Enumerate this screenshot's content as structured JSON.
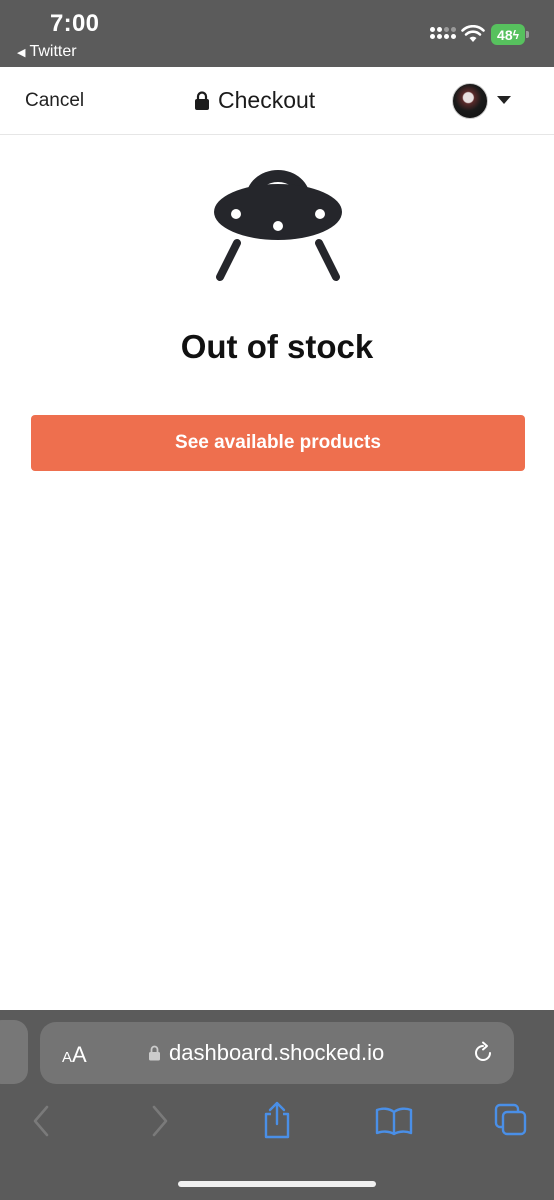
{
  "status_bar": {
    "time": "7:00",
    "back_app": "Twitter",
    "battery": "48"
  },
  "header": {
    "cancel_label": "Cancel",
    "title": "Checkout",
    "lock_icon": "lock-icon",
    "avatar_menu_icon": "caret-down-icon"
  },
  "main": {
    "illustration": "ufo-icon",
    "heading": "Out of stock",
    "cta_label": "See available products",
    "cta_color": "#ee6f4e"
  },
  "browser": {
    "text_size_label_big": "A",
    "text_size_label_small": "A",
    "url": "dashboard.shocked.io",
    "icons": [
      "back-icon",
      "forward-icon",
      "share-icon",
      "bookmarks-icon",
      "tabs-icon",
      "reload-icon"
    ],
    "accent": "#4a8fe7"
  }
}
